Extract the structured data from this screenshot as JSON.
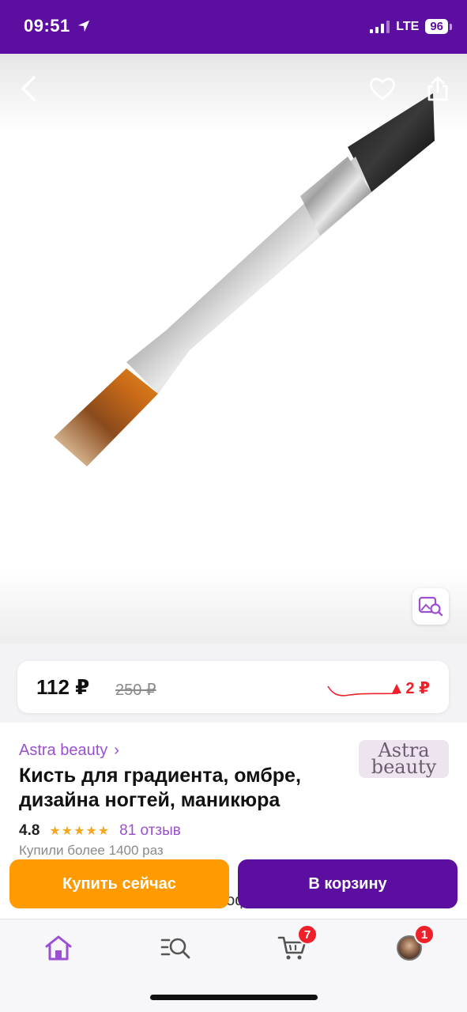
{
  "status_bar": {
    "time": "09:51",
    "network": "LTE",
    "battery": "96",
    "icons": [
      "location-arrow-icon",
      "signal-icon",
      "battery-icon"
    ]
  },
  "gallery": {
    "image_subject": "nail-art-brush",
    "icons": [
      "back-icon",
      "heart-icon",
      "share-icon",
      "visual-search-icon"
    ]
  },
  "price": {
    "current": "112 ₽",
    "old": "250 ₽",
    "change": "2 ₽",
    "change_icon": "triangle-up-icon",
    "change_color": "#f0202a"
  },
  "seller": {
    "name": "Astra beauty",
    "chevron": "›",
    "logo_line1": "Astra",
    "logo_line2": "beauty"
  },
  "product": {
    "title": "Кисть для градиента, омбре, дизайна ногтей, маникюра",
    "rating": "4.8",
    "stars": "★★★★★",
    "reviews": "81 отзыв",
    "bought": "Купили более 1400 раз",
    "description_peek": "градиента. Подходит для профессионального"
  },
  "actions": {
    "buy_now": "Купить сейчас",
    "add_to_cart": "В корзину"
  },
  "tab_bar": {
    "cart_badge": "7",
    "profile_badge": "1",
    "icons": [
      "home-icon",
      "catalog-search-icon",
      "cart-icon",
      "avatar"
    ]
  },
  "colors": {
    "brand": "#5b0ea0",
    "accent_orange": "#ff9a00",
    "link_purple": "#9b4fd1",
    "badge_red": "#f0202a"
  }
}
